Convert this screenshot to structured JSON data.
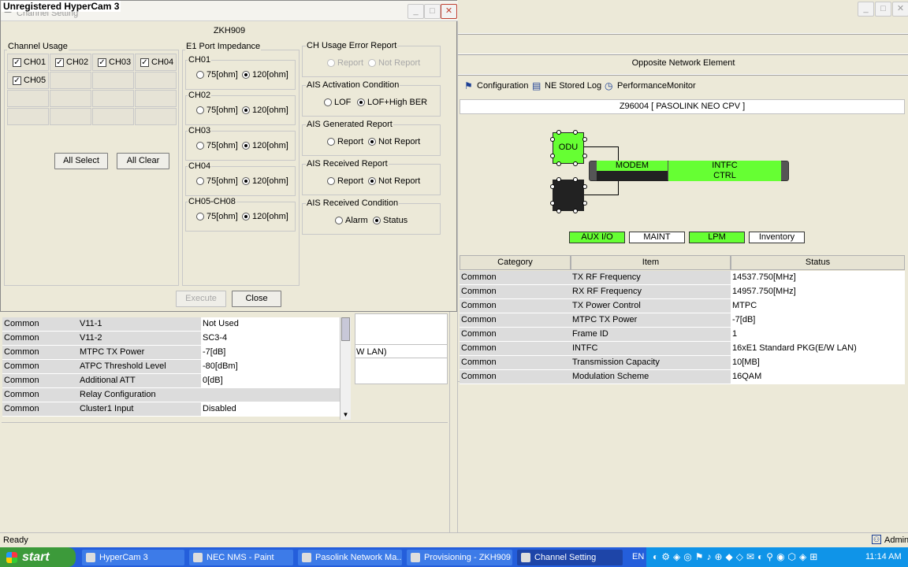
{
  "hypercam": {
    "title": "Unregistered HyperCam 3"
  },
  "dialog": {
    "title": "Channel Setting",
    "ne_name": "ZKH909",
    "channel_usage": {
      "label": "Channel Usage",
      "channels": [
        "CH01",
        "CH02",
        "CH03",
        "CH04",
        "CH05"
      ],
      "all_select": "All Select",
      "all_clear": "All Clear"
    },
    "e1_impedance": {
      "label": "E1 Port Impedance",
      "groups": [
        {
          "name": "CH01",
          "opt1": "75[ohm]",
          "opt2": "120[ohm]"
        },
        {
          "name": "CH02",
          "opt1": "75[ohm]",
          "opt2": "120[ohm]"
        },
        {
          "name": "CH03",
          "opt1": "75[ohm]",
          "opt2": "120[ohm]"
        },
        {
          "name": "CH04",
          "opt1": "75[ohm]",
          "opt2": "120[ohm]"
        },
        {
          "name": "CH05-CH08",
          "opt1": "75[ohm]",
          "opt2": "120[ohm]"
        }
      ]
    },
    "reports": [
      {
        "label": "CH Usage Error Report",
        "opt1": "Report",
        "opt2": "Not Report"
      },
      {
        "label": "AIS Activation Condition",
        "opt1": "LOF",
        "opt2": "LOF+High BER"
      },
      {
        "label": "AIS Generated Report",
        "opt1": "Report",
        "opt2": "Not Report"
      },
      {
        "label": "AIS Received Report",
        "opt1": "Report",
        "opt2": "Not Report"
      },
      {
        "label": "AIS Received Condition",
        "opt1": "Alarm",
        "opt2": "Status"
      }
    ],
    "execute": "Execute",
    "close": "Close"
  },
  "right": {
    "opposite_title": "Opposite Network Element",
    "toolbar": {
      "configuration": "Configuration",
      "ne_stored_log": "NE Stored Log",
      "performance_monitor": "PerformanceMonitor"
    },
    "ne_label": "Z96004 [ PASOLINK NEO CPV ]",
    "diagram": {
      "odu": "ODU",
      "modem": "MODEM",
      "intfc": "INTFC",
      "ctrl": "CTRL"
    },
    "buttons": {
      "aux_io": "AUX I/O",
      "maint": "MAINT",
      "lpm": "LPM",
      "inventory": "Inventory"
    },
    "colors": {
      "green": "#66ff33"
    },
    "headers": {
      "category": "Category",
      "item": "Item",
      "status": "Status"
    },
    "rows": [
      {
        "category": "Common",
        "item": "TX RF Frequency",
        "status": "14537.750[MHz]"
      },
      {
        "category": "Common",
        "item": "RX RF Frequency",
        "status": "14957.750[MHz]"
      },
      {
        "category": "Common",
        "item": "TX Power Control",
        "status": "MTPC"
      },
      {
        "category": "Common",
        "item": "MTPC TX Power",
        "status": "-7[dB]"
      },
      {
        "category": "Common",
        "item": "Frame ID",
        "status": "1"
      },
      {
        "category": "Common",
        "item": "INTFC",
        "status": "16xE1 Standard PKG(E/W LAN)"
      },
      {
        "category": "Common",
        "item": "Transmission Capacity",
        "status": "10[MB]"
      },
      {
        "category": "Common",
        "item": "Modulation Scheme",
        "status": "16QAM"
      }
    ]
  },
  "left_table": {
    "rows": [
      {
        "category": "Common",
        "item": "V11-1",
        "status": "Not Used"
      },
      {
        "category": "Common",
        "item": "V11-2",
        "status": "SC3-4"
      },
      {
        "category": "Common",
        "item": "MTPC TX Power",
        "status": "-7[dB]"
      },
      {
        "category": "Common",
        "item": "ATPC Threshold Level",
        "status": "-80[dBm]"
      },
      {
        "category": "Common",
        "item": "Additional ATT",
        "status": "0[dB]"
      },
      {
        "category": "Common",
        "item": "Relay Configuration",
        "status": ""
      },
      {
        "category": "Common",
        "item": "Cluster1 Input",
        "status": "Disabled"
      }
    ],
    "partial_text": "W LAN)"
  },
  "status_bar": {
    "text": "Ready",
    "user": "Admin"
  },
  "taskbar": {
    "start": "start",
    "tasks": [
      "HyperCam 3",
      "NEC NMS - Paint",
      "Pasolink Network Ma...",
      "Provisioning - ZKH909",
      "Channel Setting"
    ],
    "lang": "EN",
    "clock": "11:14 AM"
  }
}
